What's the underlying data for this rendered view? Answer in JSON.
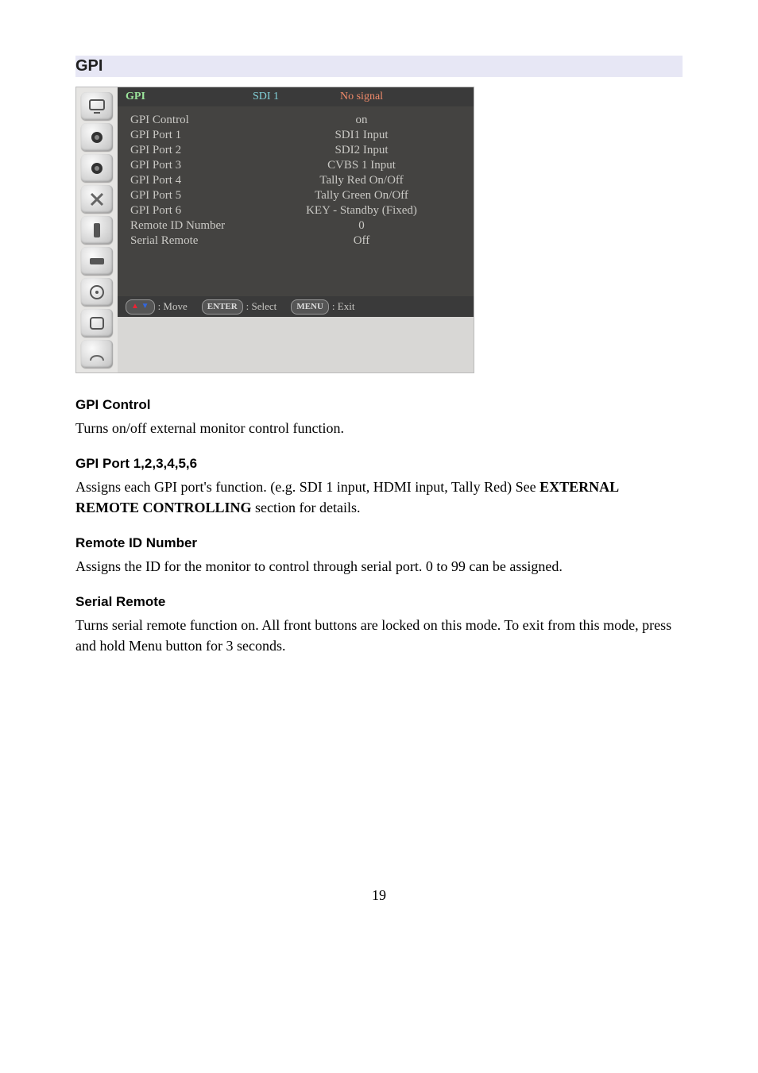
{
  "section_title": "GPI",
  "osd": {
    "header": {
      "title": "GPI",
      "input": "SDI 1",
      "status": "No signal"
    },
    "rows": [
      {
        "label": "GPI Control",
        "value": "on"
      },
      {
        "label": "GPI Port 1",
        "value": "SDI1 Input"
      },
      {
        "label": "GPI Port 2",
        "value": "SDI2 Input"
      },
      {
        "label": "GPI Port 3",
        "value": "CVBS 1 Input"
      },
      {
        "label": "GPI Port 4",
        "value": "Tally Red On/Off"
      },
      {
        "label": "GPI Port 5",
        "value": "Tally Green On/Off"
      },
      {
        "label": "GPI Port 6",
        "value": "KEY - Standby (Fixed)"
      },
      {
        "label": "Remote ID Number",
        "value": "0"
      },
      {
        "label": "Serial Remote",
        "value": "Off"
      }
    ],
    "footer": {
      "move": ": Move",
      "enter_key": "ENTER",
      "select": ": Select",
      "menu_key": "MENU",
      "exit": ": Exit"
    }
  },
  "doc": {
    "gpi_control": {
      "heading": "GPI Control",
      "text": "Turns on/off external monitor control function."
    },
    "gpi_port": {
      "heading": "GPI Port 1,2,3,4,5,6",
      "text_pre": "Assigns each GPI port's function. (e.g. SDI 1 input, HDMI input, Tally Red) See ",
      "strong": "EXTERNAL REMOTE CONTROLLING",
      "text_post": " section for details."
    },
    "remote_id": {
      "heading": "Remote ID Number",
      "text": "Assigns the ID for the monitor to control through serial port. 0 to 99 can be assigned."
    },
    "serial_remote": {
      "heading": "Serial Remote",
      "text": "Turns serial remote function on. All front buttons are locked on this mode. To exit from this mode, press and hold Menu button for 3 seconds."
    }
  },
  "page_number": "19"
}
